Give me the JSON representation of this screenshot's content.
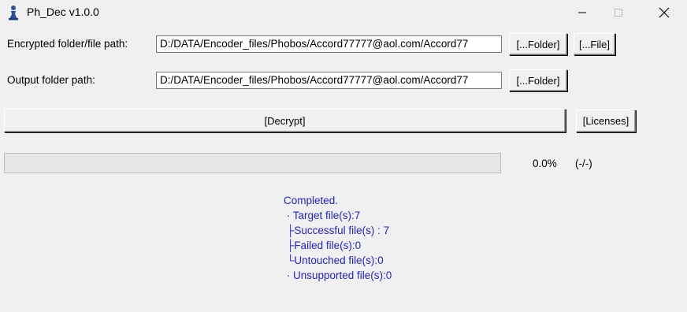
{
  "window": {
    "title": "Ph_Dec v1.0.0",
    "icons": {
      "app": "pawn-icon",
      "minimize": "minimize-icon",
      "maximize": "maximize-icon",
      "close": "close-icon"
    }
  },
  "encrypted_row": {
    "label": "Encrypted folder/file path:",
    "value": "D:/DATA/Encoder_files/Phobos/Accord77777@aol.com/Accord77",
    "folder_button": "[...Folder]",
    "file_button": "[...File]"
  },
  "output_row": {
    "label": "Output folder path:",
    "value": "D:/DATA/Encoder_files/Phobos/Accord77777@aol.com/Accord77",
    "folder_button": "[...Folder]"
  },
  "actions": {
    "decrypt_button": "[Decrypt]",
    "licenses_button": "[Licenses]"
  },
  "progress": {
    "fraction": 0.0,
    "percent_text": "0.0%",
    "count_text": "(-/-)"
  },
  "status": {
    "color": "#2222cc",
    "lines": [
      "Completed.",
      " · Target file(s):7",
      " ├Successful file(s) : 7",
      " ├Failed file(s):0",
      " └Untouched file(s):0",
      " · Unsupported file(s):0"
    ]
  }
}
